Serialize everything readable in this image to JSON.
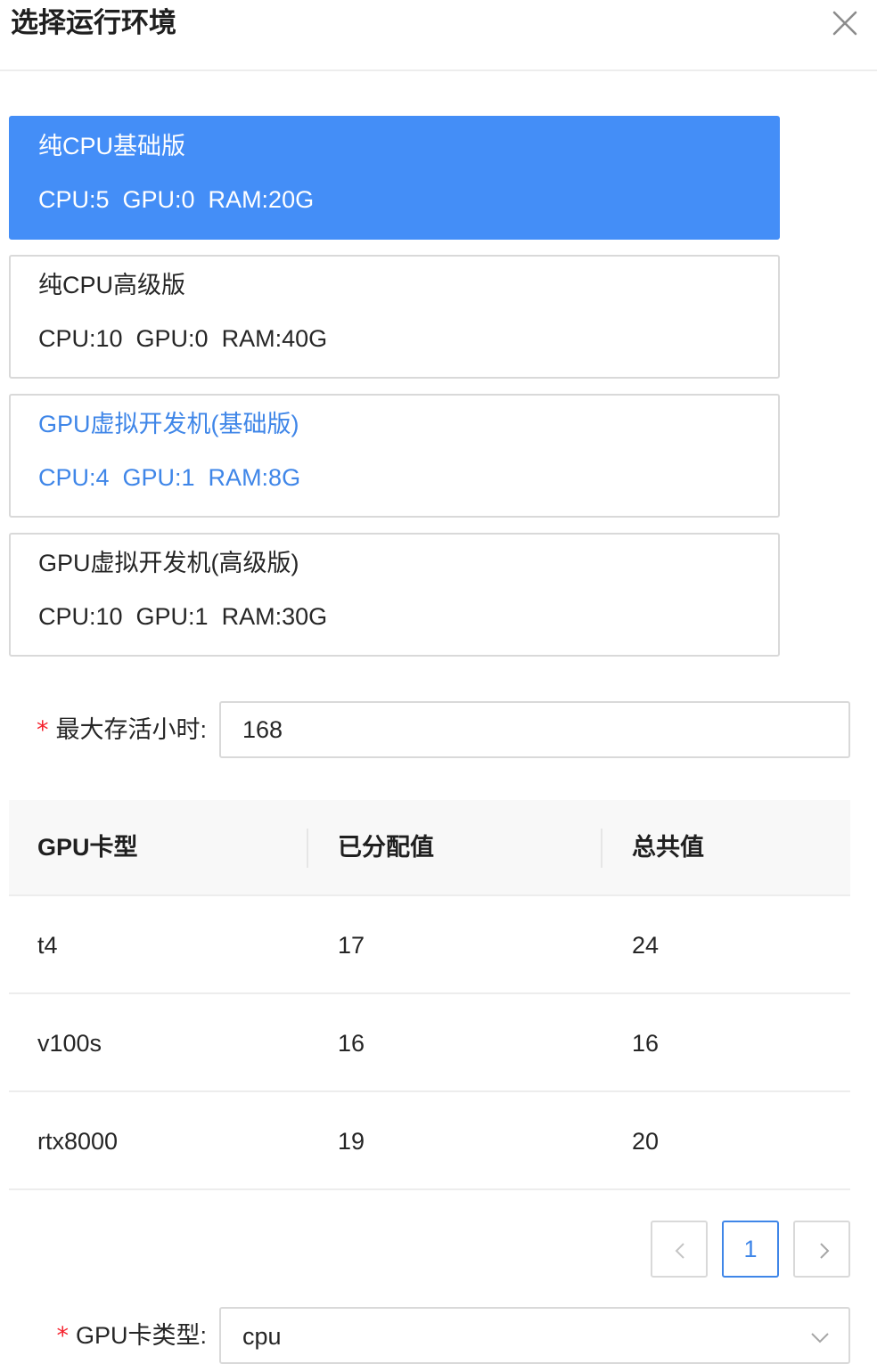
{
  "dialog": {
    "title": "选择运行环境"
  },
  "environments": [
    {
      "name": "纯CPU基础版",
      "specs": "CPU:5  GPU:0  RAM:20G",
      "state": "selected"
    },
    {
      "name": "纯CPU高级版",
      "specs": "CPU:10  GPU:0  RAM:40G",
      "state": "normal"
    },
    {
      "name": "GPU虚拟开发机(基础版)",
      "specs": "CPU:4  GPU:1  RAM:8G",
      "state": "hover"
    },
    {
      "name": "GPU虚拟开发机(高级版)",
      "specs": "CPU:10  GPU:1  RAM:30G",
      "state": "normal"
    }
  ],
  "max_hours": {
    "required_mark": "*",
    "label": "最大存活小时",
    "colon": ":",
    "value": "168"
  },
  "gpu_table": {
    "headers": [
      "GPU卡型",
      "已分配值",
      "总共值"
    ],
    "rows": [
      [
        "t4",
        "17",
        "24"
      ],
      [
        "v100s",
        "16",
        "16"
      ],
      [
        "rtx8000",
        "19",
        "20"
      ]
    ]
  },
  "pagination": {
    "current_page": "1"
  },
  "gpu_type": {
    "required_mark": "*",
    "label": "GPU卡类型",
    "colon": ":",
    "value": "cpu"
  },
  "icons": {
    "close": "close-icon",
    "prev": "chevron-left-icon",
    "next": "chevron-right-icon",
    "dropdown": "chevron-down-icon"
  },
  "colors": {
    "primary": "#448ef7",
    "link": "#3f86e8",
    "required": "#f5222d",
    "header_bg": "#f8f8f8"
  }
}
